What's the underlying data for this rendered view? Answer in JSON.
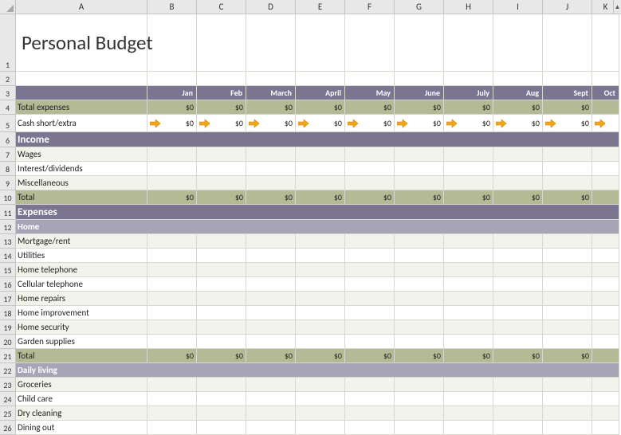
{
  "columns": [
    "A",
    "B",
    "C",
    "D",
    "E",
    "F",
    "G",
    "H",
    "I",
    "J",
    "K"
  ],
  "title": "Personal Budget",
  "months": [
    "Jan",
    "Feb",
    "March",
    "April",
    "May",
    "June",
    "July",
    "Aug",
    "Sept",
    "Oct"
  ],
  "zero": "$0",
  "rows": {
    "total_expenses": "Total expenses",
    "cash_short": "Cash short/extra",
    "income": "Income",
    "wages": "Wages",
    "interest": "Interest/dividends",
    "misc": "Miscellaneous",
    "total": "Total",
    "expenses": "Expenses",
    "home": "Home",
    "mortgage": "Mortgage/rent",
    "utilities": "Utilities",
    "home_tel": "Home telephone",
    "cell_tel": "Cellular telephone",
    "repairs": "Home repairs",
    "improvement": "Home improvement",
    "security": "Home security",
    "garden": "Garden supplies",
    "daily_living": "Daily living",
    "groceries": "Groceries",
    "child_care": "Child care",
    "dry_cleaning": "Dry cleaning",
    "dining_out": "Dining out"
  },
  "rownums": [
    "1",
    "2",
    "3",
    "4",
    "5",
    "6",
    "7",
    "8",
    "9",
    "10",
    "11",
    "12",
    "13",
    "14",
    "15",
    "16",
    "17",
    "18",
    "19",
    "20",
    "21",
    "22",
    "23",
    "24",
    "25",
    "26"
  ]
}
